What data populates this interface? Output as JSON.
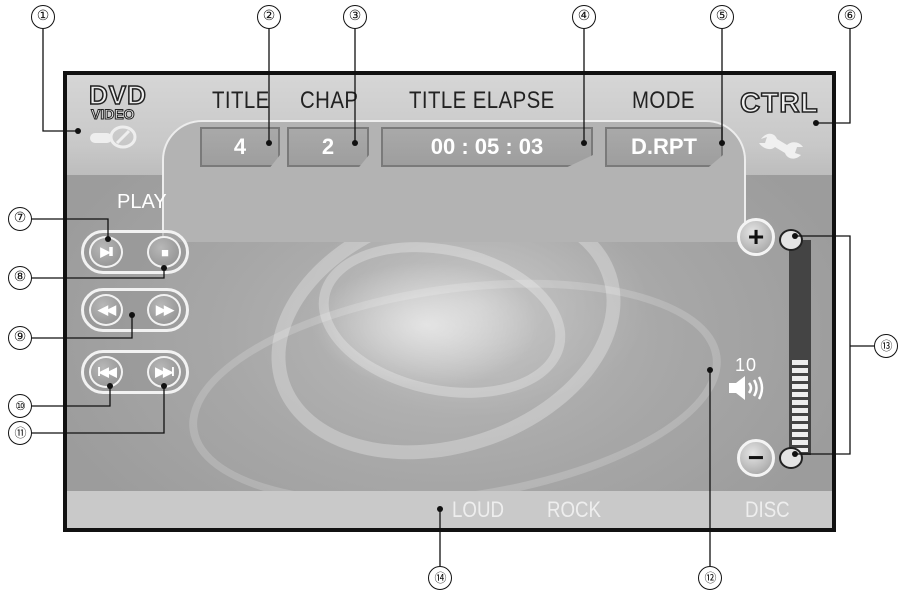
{
  "header": {
    "logo_dvd": "DVD",
    "logo_video": "VIDEO",
    "title_label": "TITLE",
    "chap_label": "CHAP",
    "elapse_label": "TITLE ELAPSE",
    "mode_label": "MODE",
    "ctrl_label": "CTRL"
  },
  "status": {
    "title_value": "4",
    "chapter_value": "2",
    "elapsed_time": "00 : 05 : 03",
    "mode_value": "D.RPT"
  },
  "transport": {
    "play_label": "PLAY",
    "play_pause_glyph": "▶II",
    "stop_glyph": "■",
    "rewind_glyph": "◀◀",
    "fast_forward_glyph": "▶▶",
    "prev_glyph": "I◀◀",
    "next_glyph": "▶▶I"
  },
  "volume": {
    "plus_glyph": "+",
    "minus_glyph": "−",
    "level": "10",
    "icon": "speaker-icon"
  },
  "bottom_bar": {
    "loud": "LOUD",
    "rock": "ROCK",
    "disc": "DISC"
  },
  "callouts": [
    "①",
    "②",
    "③",
    "④",
    "⑤",
    "⑥",
    "⑦",
    "⑧",
    "⑨",
    "⑩",
    "⑪",
    "⑫",
    "⑬",
    "⑭"
  ],
  "colors": {
    "screen_bg": "#a8a8a8",
    "bar_bg": "#cfcfcf",
    "volume_track": "#444444",
    "frame": "#111111"
  }
}
